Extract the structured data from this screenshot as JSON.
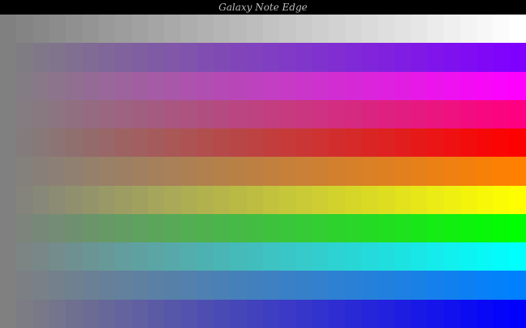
{
  "window": {
    "title": "Galaxy Note Edge"
  },
  "gradient": {
    "start_color": "#808080",
    "steps": 32,
    "bands": [
      {
        "name": "gray-to-white",
        "end_color": "#ffffff"
      },
      {
        "name": "gray-to-violet",
        "end_color": "#8000ff"
      },
      {
        "name": "gray-to-magenta",
        "end_color": "#ff00ff"
      },
      {
        "name": "gray-to-rose",
        "end_color": "#ff0080"
      },
      {
        "name": "gray-to-red",
        "end_color": "#ff0000"
      },
      {
        "name": "gray-to-orange",
        "end_color": "#ff8000"
      },
      {
        "name": "gray-to-yellow",
        "end_color": "#ffff00"
      },
      {
        "name": "gray-to-green",
        "end_color": "#00ff00"
      },
      {
        "name": "gray-to-cyan",
        "end_color": "#00ffff"
      },
      {
        "name": "gray-to-azure",
        "end_color": "#0080ff"
      },
      {
        "name": "gray-to-blue",
        "end_color": "#0000ff"
      }
    ]
  }
}
